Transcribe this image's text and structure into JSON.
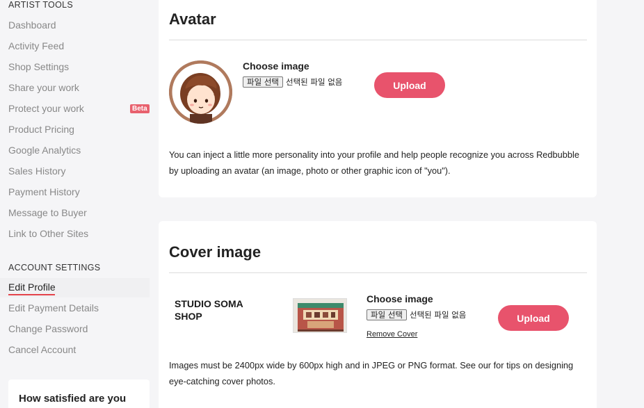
{
  "sidebar": {
    "artist_tools_title": "ARTIST TOOLS",
    "artist_items": [
      {
        "label": "Dashboard"
      },
      {
        "label": "Activity Feed"
      },
      {
        "label": "Shop Settings"
      },
      {
        "label": "Share your work"
      },
      {
        "label": "Protect your work",
        "badge": "Beta"
      },
      {
        "label": "Product Pricing"
      },
      {
        "label": "Google Analytics"
      },
      {
        "label": "Sales History"
      },
      {
        "label": "Payment History"
      },
      {
        "label": "Message to Buyer"
      },
      {
        "label": "Link to Other Sites"
      }
    ],
    "account_settings_title": "ACCOUNT SETTINGS",
    "account_items": [
      {
        "label": "Edit Profile",
        "active": true
      },
      {
        "label": "Edit Payment Details"
      },
      {
        "label": "Change Password"
      },
      {
        "label": "Cancel Account"
      }
    ],
    "survey_title": "How satisfied are you with Redbubble"
  },
  "avatar_card": {
    "title": "Avatar",
    "choose_label": "Choose image",
    "file_button": "파일 선택",
    "file_status": "선택된 파일 없음",
    "upload_label": "Upload",
    "description": "You can inject a little more personality into your profile and help people recognize you across Redbubble by uploading an avatar (an image, photo or other graphic icon of \"you\")."
  },
  "cover_card": {
    "title": "Cover image",
    "shop_name": "STUDIO SOMA SHOP",
    "choose_label": "Choose image",
    "file_button": "파일 선택",
    "file_status": "선택된 파일 없음",
    "upload_label": "Upload",
    "remove_label": "Remove Cover",
    "description": "Images must be 2400px wide by 600px high and in JPEG or PNG format. See our for tips on designing eye-catching cover photos."
  },
  "colors": {
    "accent": "#e8536c",
    "annotation": "#e8101e",
    "beta_badge": "#e8616e"
  }
}
